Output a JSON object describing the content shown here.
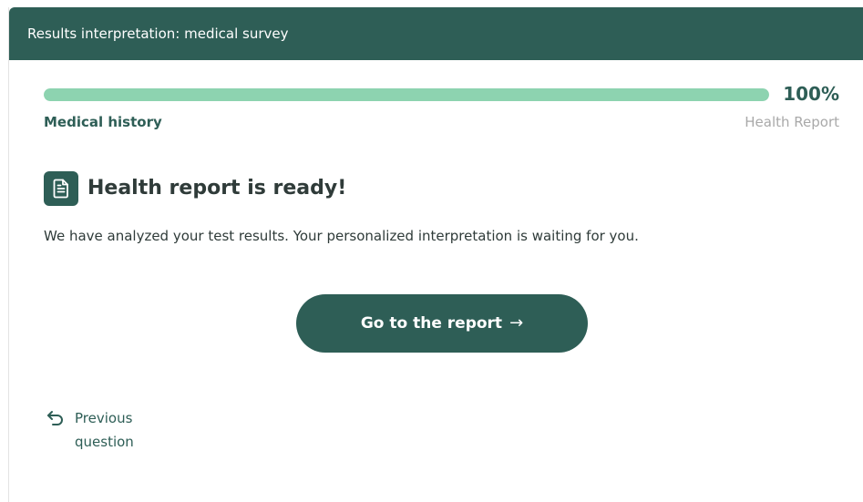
{
  "header": {
    "title": "Results interpretation: medical survey"
  },
  "progress": {
    "percent_label": "100%",
    "value": 1.0,
    "left_step": "Medical history",
    "right_step": "Health Report"
  },
  "ready": {
    "icon": "document-icon",
    "title": "Health report is ready!",
    "description": "We have analyzed your test results. Your personalized interpretation is waiting for you."
  },
  "cta": {
    "label": "Go to the report",
    "arrow": "→"
  },
  "previous": {
    "icon": "undo-arrow-icon",
    "label": "Previous question"
  },
  "colors": {
    "brand": "#2e5e56",
    "progress_fill": "#8dd3b0",
    "muted_text": "#a9a9a9"
  }
}
